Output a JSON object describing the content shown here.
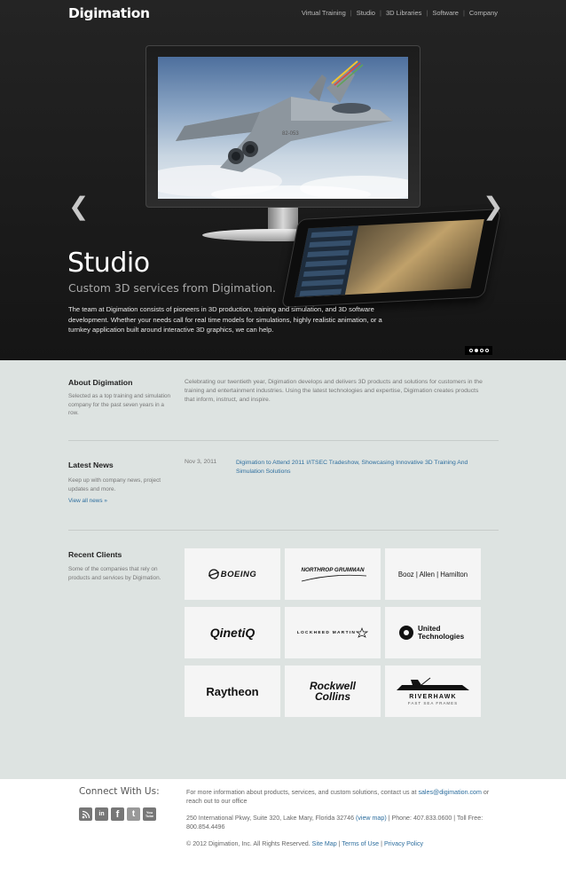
{
  "header": {
    "logo": "Digimation",
    "nav": [
      "Virtual Training",
      "Studio",
      "3D Libraries",
      "Software",
      "Company"
    ],
    "nav_separator": "|"
  },
  "hero": {
    "title": "Studio",
    "subtitle": "Custom 3D services from Digimation.",
    "description": "The team at Digimation consists of pioneers in 3D production, training and simulation, and 3D software development. Whether your needs call for real time models for simulations, highly realistic animation, or a turnkey application built around interactive 3D graphics, we can help.",
    "prev_icon": "chevron-left-icon",
    "next_icon": "chevron-right-icon",
    "prev_glyph": "❮",
    "next_glyph": "❯",
    "slides_total": 4,
    "active_slide": 2,
    "aircraft_code": "82-053"
  },
  "about": {
    "title": "About Digimation",
    "description": "Selected as a top training and simulation company for the past seven years in a row.",
    "body": "Celebrating our twentieth year, Digimation develops and delivers 3D products and solutions for customers in the training and entertainment industries. Using the latest technologies and expertise, Digimation creates products that inform, instruct, and inspire."
  },
  "news": {
    "title": "Latest News",
    "description": "Keep up with company news, project updates and more.",
    "view_all": "View all news »",
    "items": [
      {
        "date": "Nov 3, 2011",
        "headline": "Digimation to Attend 2011 I/ITSEC Tradeshow, Showcasing Innovative 3D Training And Simulation Solutions"
      }
    ]
  },
  "clients": {
    "title": "Recent Clients",
    "description": "Some of the companies that rely on products and services by Digimation.",
    "logos": [
      "BOEING",
      "NORTHROP GRUMMAN",
      "Booz | Allen | Hamilton",
      "QinetiQ",
      "LOCKHEED MARTIN",
      "United Technologies",
      "Raytheon",
      "Rockwell Collins",
      "RIVERHAWK",
      "FAST SEA FRAMES"
    ]
  },
  "footer": {
    "connect_title": "Connect With Us:",
    "socials": [
      {
        "name": "rss",
        "label": ""
      },
      {
        "name": "linkedin",
        "label": "in"
      },
      {
        "name": "facebook",
        "label": "f"
      },
      {
        "name": "twitter",
        "label": "t"
      },
      {
        "name": "youtube",
        "label": "You Tube"
      }
    ],
    "contact_prefix": "For more information about products, services, and custom solutions, contact us at",
    "email": "sales@digimation.com",
    "contact_suffix": "or reach out to our office",
    "address": "250 International Pkwy, Suite 320, Lake Mary, Florida 32746",
    "view_map": "(view map)",
    "phone": "| Phone: 407.833.0600 | Toll Free: 800.854.4496",
    "copyright": "© 2012 Digimation, Inc. All Rights Reserved.",
    "links": [
      "Site Map",
      "Terms of Use",
      "Privacy Policy"
    ],
    "link_separator": "|"
  },
  "colors": {
    "hero_bg": "#1c1c1c",
    "main_bg": "#dde3e1",
    "link": "#2d6e9e",
    "footer_bg": "#ffffff"
  }
}
